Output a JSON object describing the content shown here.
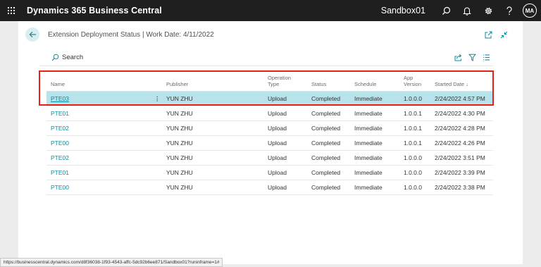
{
  "topbar": {
    "app_title": "Dynamics 365 Business Central",
    "environment": "Sandbox01",
    "avatar_initials": "MA"
  },
  "page": {
    "title": "Extension Deployment Status | Work Date: 4/11/2022"
  },
  "actions": {
    "search_label": "Search"
  },
  "table": {
    "headers": {
      "name": "Name",
      "publisher": "Publisher",
      "operation_type_line1": "Operation",
      "operation_type_line2": "Type",
      "status": "Status",
      "schedule": "Schedule",
      "app_version_line1": "App",
      "app_version_line2": "Version",
      "started_date": "Started Date ↓"
    },
    "rows": [
      {
        "name": "PTE03",
        "publisher": "YUN ZHU",
        "operation_type": "Upload",
        "status": "Completed",
        "schedule": "Immediate",
        "app_version": "1.0.0.0",
        "started_date": "2/24/2022 4:57 PM"
      },
      {
        "name": "PTE01",
        "publisher": "YUN ZHU",
        "operation_type": "Upload",
        "status": "Completed",
        "schedule": "Immediate",
        "app_version": "1.0.0.1",
        "started_date": "2/24/2022 4:30 PM"
      },
      {
        "name": "PTE02",
        "publisher": "YUN ZHU",
        "operation_type": "Upload",
        "status": "Completed",
        "schedule": "Immediate",
        "app_version": "1.0.0.1",
        "started_date": "2/24/2022 4:28 PM"
      },
      {
        "name": "PTE00",
        "publisher": "YUN ZHU",
        "operation_type": "Upload",
        "status": "Completed",
        "schedule": "Immediate",
        "app_version": "1.0.0.1",
        "started_date": "2/24/2022 4:26 PM"
      },
      {
        "name": "PTE02",
        "publisher": "YUN ZHU",
        "operation_type": "Upload",
        "status": "Completed",
        "schedule": "Immediate",
        "app_version": "1.0.0.0",
        "started_date": "2/24/2022 3:51 PM"
      },
      {
        "name": "PTE01",
        "publisher": "YUN ZHU",
        "operation_type": "Upload",
        "status": "Completed",
        "schedule": "Immediate",
        "app_version": "1.0.0.0",
        "started_date": "2/24/2022 3:39 PM"
      },
      {
        "name": "PTE00",
        "publisher": "YUN ZHU",
        "operation_type": "Upload",
        "status": "Completed",
        "schedule": "Immediate",
        "app_version": "1.0.0.0",
        "started_date": "2/24/2022 3:38 PM"
      }
    ]
  },
  "statusbar": {
    "url": "https://businesscentral.dynamics.com/d8f36038-1f93-4543-affc-5dc92b6ee871/Sandbox01?runinframe=1#"
  },
  "colors": {
    "topbar": "#1f1f1f",
    "accent": "#0e8a9e",
    "selected_row": "#b6e4ea",
    "highlight_border": "#e2231a"
  },
  "icons": {
    "app_launcher": "waffle-icon",
    "search": "search-icon",
    "notifications": "bell-icon",
    "settings": "gear-icon",
    "help": "help-icon",
    "back": "back-arrow-icon",
    "open_new_window": "open-new-window-icon",
    "collapse": "collapse-icon",
    "share": "share-icon",
    "filter": "filter-icon",
    "list_view": "list-view-icon",
    "row_menu": "more-vertical-icon"
  }
}
